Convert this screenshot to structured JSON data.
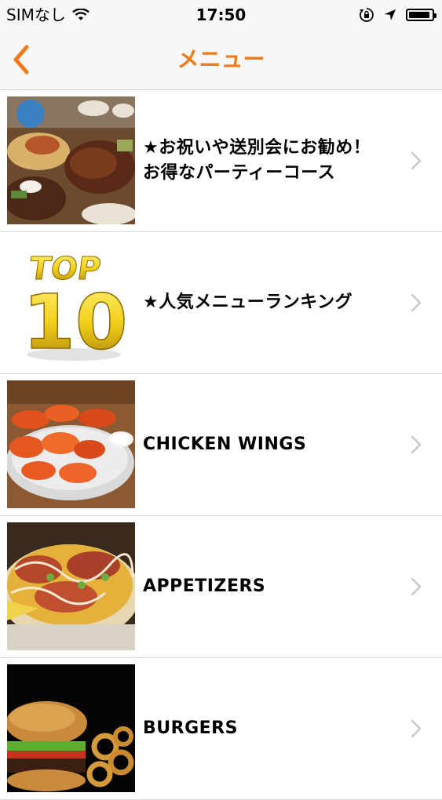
{
  "status": {
    "carrier": "SIMなし",
    "time": "17:50"
  },
  "nav": {
    "title": "メニュー",
    "accent_color": "#f07a1a"
  },
  "menu_items": [
    {
      "label": "★お祝いや送別会にお勧め！\nお得なパーティーコース",
      "thumb": "party-course-photo"
    },
    {
      "label": "★人気メニューランキング",
      "thumb": "top10-logo"
    },
    {
      "label": "CHICKEN WINGS",
      "thumb": "chicken-wings-photo"
    },
    {
      "label": "APPETIZERS",
      "thumb": "nachos-photo"
    },
    {
      "label": "BURGERS",
      "thumb": "burger-photo"
    }
  ],
  "top10_logo_text": {
    "top": "TOP",
    "number": "10"
  }
}
